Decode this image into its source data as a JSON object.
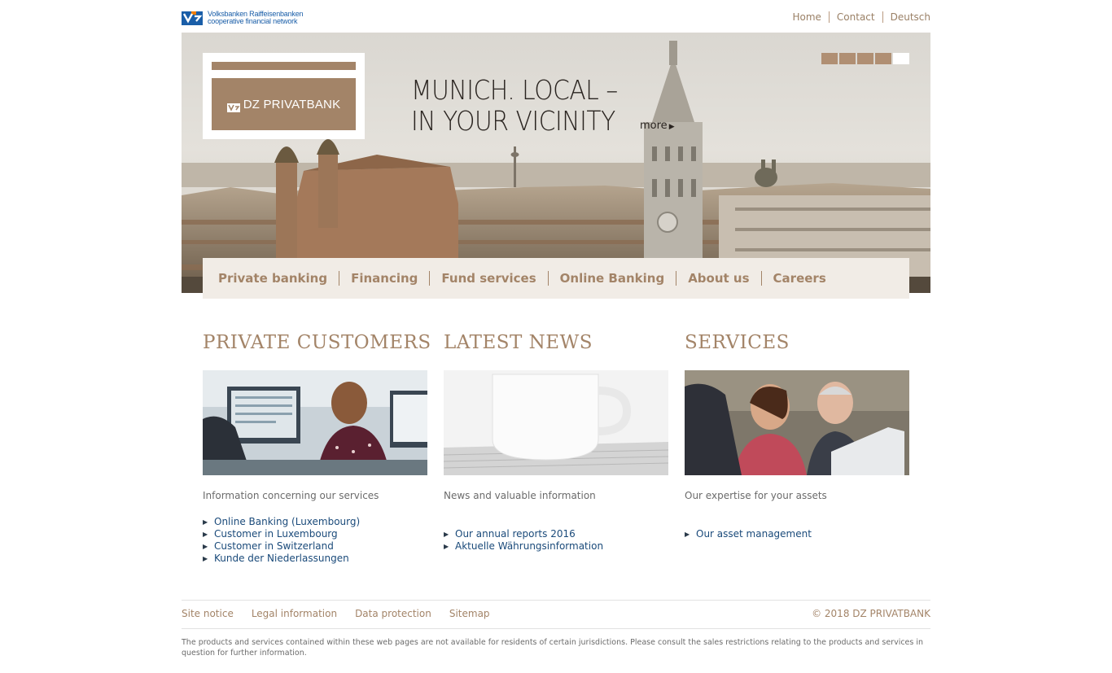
{
  "header": {
    "logo_line1": "Volksbanken Raiffeisenbanken",
    "logo_line2": "cooperative financial network",
    "links": [
      "Home",
      "Contact",
      "Deutsch"
    ]
  },
  "hero": {
    "brand": "DZ PRIVATBANK",
    "headline_line1": "MUNICH. LOCAL –",
    "headline_line2": "IN YOUR VICINITY",
    "more": "more",
    "slides_total": 5,
    "slide_active": 5
  },
  "nav": [
    "Private banking",
    "Financing",
    "Fund services",
    "Online Banking",
    "About us",
    "Careers"
  ],
  "columns": [
    {
      "title": "PRIVATE CUSTOMERS",
      "subtitle": "Information concerning our services",
      "links": [
        "Online Banking (Luxembourg)",
        "Customer in Luxembourg",
        "Customer in Switzerland",
        "Kunde der Niederlassungen"
      ]
    },
    {
      "title": "LATEST NEWS",
      "subtitle": "News and valuable information",
      "links": [
        "Our annual reports 2016",
        "Aktuelle Währungsinformation"
      ]
    },
    {
      "title": "SERVICES",
      "subtitle": "Our expertise for your assets",
      "links": [
        "Our asset management"
      ]
    }
  ],
  "footer": {
    "links": [
      "Site notice",
      "Legal information",
      "Data protection",
      "Sitemap"
    ],
    "copyright": "© 2018 DZ PRIVATBANK",
    "disclaimer": "The products and services contained within these web pages are not available for residents of certain jurisdictions. Please consult the sales restrictions relating to the products and services in question for further information."
  },
  "colors": {
    "accent": "#a38468",
    "link": "#1a4a7a",
    "nav_bg": "#f1ece6",
    "logo_blue": "#1a5ea8",
    "logo_orange": "#f07d00"
  }
}
